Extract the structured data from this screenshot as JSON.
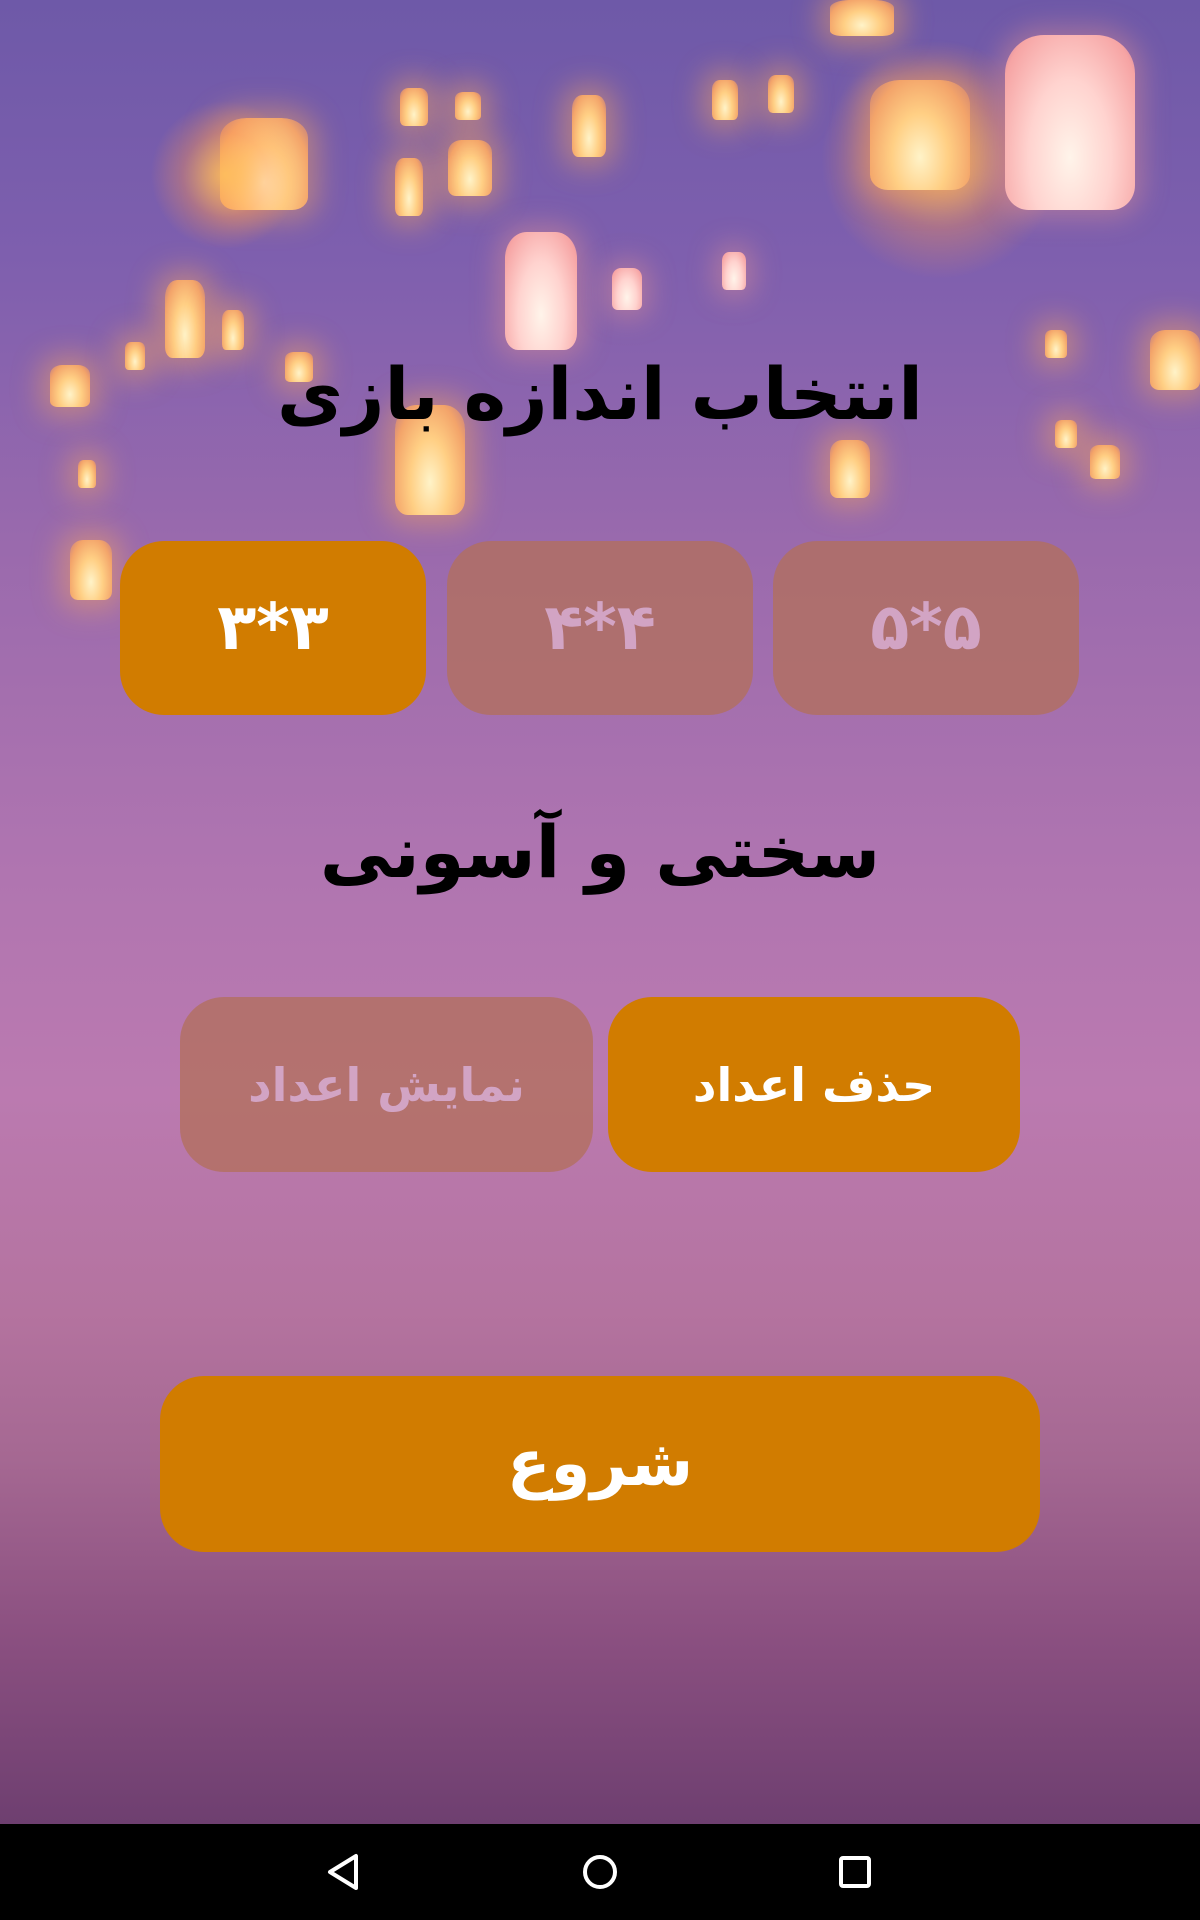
{
  "size_section": {
    "title": "انتخاب اندازه بازی",
    "options": [
      {
        "label": "۳*۳",
        "selected": true
      },
      {
        "label": "۴*۴",
        "selected": false
      },
      {
        "label": "۵*۵",
        "selected": false
      }
    ]
  },
  "difficulty_section": {
    "title": "سختی و آسونی",
    "options": [
      {
        "label": "حذف اعداد",
        "selected": true
      },
      {
        "label": "نمایش اعداد",
        "selected": false
      }
    ]
  },
  "start_button": {
    "label": "شروع"
  },
  "navigation_bar": {
    "back_icon": "back-triangle-icon",
    "home_icon": "home-circle-icon",
    "recents_icon": "recents-square-icon"
  },
  "colors": {
    "accent": "#d17c00",
    "inactive_button": "#b2705c",
    "inactive_text": "#d2a4c4",
    "background_top": "#6e59a8",
    "background_middle": "#bb7ab0",
    "navbar": "#000000"
  }
}
